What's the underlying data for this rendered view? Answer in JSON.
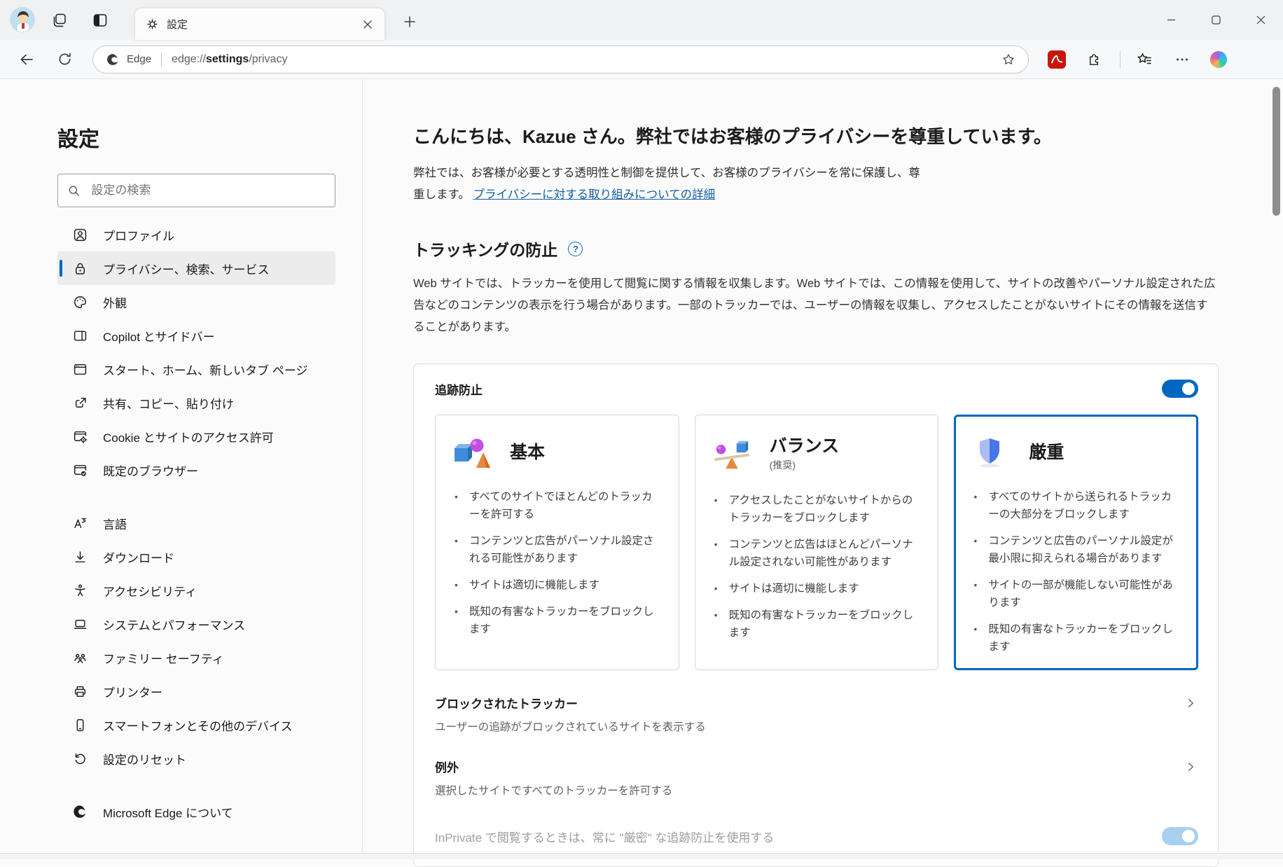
{
  "titlebar": {
    "tab_title": "設定"
  },
  "toolbar": {
    "brand": "Edge",
    "url_prefix": "edge://",
    "url_emphasis": "settings",
    "url_suffix": "/privacy"
  },
  "sidebar": {
    "title": "設定",
    "search_placeholder": "設定の検索",
    "items": [
      {
        "label": "プロファイル"
      },
      {
        "label": "プライバシー、検索、サービス"
      },
      {
        "label": "外観"
      },
      {
        "label": "Copilot とサイドバー"
      },
      {
        "label": "スタート、ホーム、新しいタブ ページ"
      },
      {
        "label": "共有、コピー、貼り付け"
      },
      {
        "label": "Cookie とサイトのアクセス許可"
      },
      {
        "label": "既定のブラウザー"
      },
      {
        "label": "言語"
      },
      {
        "label": "ダウンロード"
      },
      {
        "label": "アクセシビリティ"
      },
      {
        "label": "システムとパフォーマンス"
      },
      {
        "label": "ファミリー セーフティ"
      },
      {
        "label": "プリンター"
      },
      {
        "label": "スマートフォンとその他のデバイス"
      },
      {
        "label": "設定のリセット"
      }
    ],
    "about": "Microsoft Edge について"
  },
  "main": {
    "greeting": "こんにちは、Kazue さん。弊社ではお客様のプライバシーを尊重しています。",
    "intro_text": "弊社では、お客様が必要とする透明性と制御を提供して、お客様のプライバシーを常に保護し、尊重します。",
    "intro_link": "プライバシーに対する取り組みについての詳細",
    "section_title": "トラッキングの防止",
    "help_glyph": "?",
    "section_desc": "Web サイトでは、トラッカーを使用して閲覧に関する情報を収集します。Web サイトでは、この情報を使用して、サイトの改善やパーソナル設定された広告などのコンテンツの表示を行う場合があります。一部のトラッカーでは、ユーザーの情報を収集し、アクセスしたことがないサイトにその情報を送信することがあります。",
    "tracking_label": "追跡防止",
    "cards": [
      {
        "title": "基本",
        "bullets": [
          "すべてのサイトでほとんどのトラッカーを許可する",
          "コンテンツと広告がパーソナル設定される可能性があります",
          "サイトは適切に機能します",
          "既知の有害なトラッカーをブロックします"
        ]
      },
      {
        "title": "バランス",
        "subtitle": "(推奨)",
        "bullets": [
          "アクセスしたことがないサイトからのトラッカーをブロックします",
          "コンテンツと広告はほとんどパーソナル設定されない可能性があります",
          "サイトは適切に機能します",
          "既知の有害なトラッカーをブロックします"
        ]
      },
      {
        "title": "厳重",
        "bullets": [
          "すべてのサイトから送られるトラッカーの大部分をブロックします",
          "コンテンツと広告のパーソナル設定が最小限に抑えられる場合があります",
          "サイトの一部が機能しない可能性があります",
          "既知の有害なトラッカーをブロックします"
        ]
      }
    ],
    "blocked_trackers": {
      "title": "ブロックされたトラッカー",
      "desc": "ユーザーの追跡がブロックされているサイトを表示する"
    },
    "exceptions": {
      "title": "例外",
      "desc": "選択したサイトですべてのトラッカーを許可する"
    },
    "inprivate_label": "InPrivate で閲覧するときは、常に \"厳密\" な追跡防止を使用する"
  },
  "colors": {
    "accent": "#0067c0",
    "link": "#115ea3"
  }
}
